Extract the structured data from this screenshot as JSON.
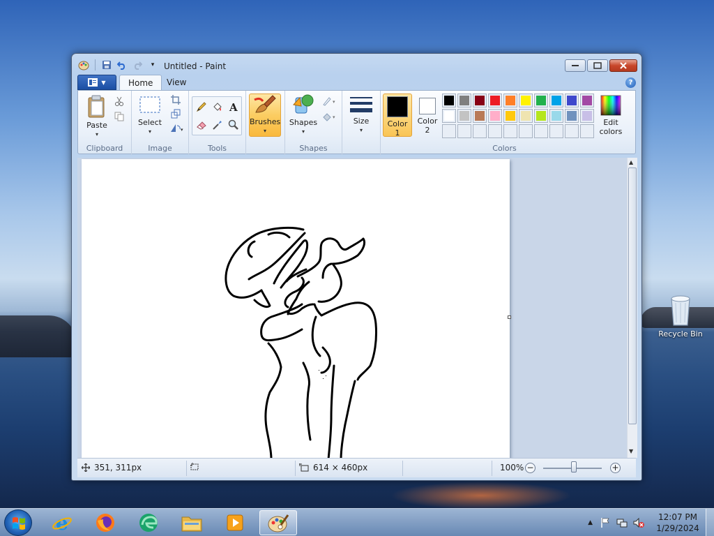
{
  "window": {
    "title": "Untitled - Paint",
    "controls": [
      "minimize-icon",
      "maximize-icon",
      "close-icon"
    ]
  },
  "ribbon": {
    "tabs": [
      {
        "label": "Home",
        "active": true
      },
      {
        "label": "View",
        "active": false
      }
    ],
    "groups": {
      "clipboard": {
        "label": "Clipboard",
        "paste": "Paste"
      },
      "image": {
        "label": "Image",
        "select": "Select"
      },
      "tools": {
        "label": "Tools"
      },
      "brushes": {
        "label": "Brushes"
      },
      "shapes": {
        "label": "Shapes",
        "shapes_button": "Shapes"
      },
      "size": {
        "label": "Size"
      },
      "colors": {
        "label": "Colors",
        "color1_label": "Color",
        "color1_num": "1",
        "color1_value": "#000000",
        "color2_label": "Color",
        "color2_num": "2",
        "color2_value": "#ffffff",
        "edit_line1": "Edit",
        "edit_line2": "colors",
        "palette_row1": [
          "#000000",
          "#7f7f7f",
          "#880015",
          "#ed1c24",
          "#ff7f27",
          "#fff200",
          "#22b14c",
          "#00a2e8",
          "#3f48cc",
          "#a349a4"
        ],
        "palette_row2": [
          "#ffffff",
          "#c3c3c3",
          "#b97a57",
          "#ffaec9",
          "#ffc90e",
          "#efe4b0",
          "#b5e61d",
          "#99d9ea",
          "#7092be",
          "#c8bfe7"
        ]
      }
    }
  },
  "canvas": {
    "background": "#ffffff"
  },
  "status": {
    "cursor_pos": "351, 311px",
    "canvas_size": "614 × 460px",
    "zoom": "100%"
  },
  "desktop": {
    "recycle_bin": "Recycle Bin"
  },
  "taskbar": {
    "apps": [
      "internet-explorer-icon",
      "firefox-icon",
      "edge-icon",
      "file-explorer-icon",
      "media-player-icon",
      "paint-icon"
    ],
    "time": "12:07 PM",
    "date": "1/29/2024"
  }
}
